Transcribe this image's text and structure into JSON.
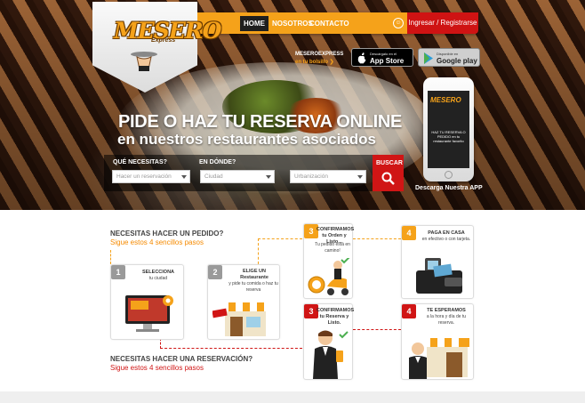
{
  "brand": {
    "logo_text": "MESERO",
    "logo_sub": "Express"
  },
  "nav": {
    "items": [
      {
        "label": "HOME",
        "active": true
      },
      {
        "label": "NOSOTROS",
        "active": false
      },
      {
        "label": "CONTACTO",
        "active": false
      }
    ],
    "login_label": "Ingresar / Registrarse"
  },
  "app_promo": {
    "title": "MESEROEXPRESS",
    "subtitle": "en tu bolsillo",
    "appstore": {
      "small": "Descárgalo en el",
      "big": "App Store"
    },
    "gplay": {
      "small": "Disponible en",
      "big": "Google play"
    },
    "phone_logo": "MESERO",
    "phone_text": "HAZ TU RESERVA O PEDIDO en tu restaurante favorito",
    "caption": "Descarga Nuestra APP"
  },
  "hero": {
    "headline": "PIDE O HAZ TU RESERVA ONLINE",
    "subheadline": "en nuestros restaurantes asociados"
  },
  "search": {
    "q_label": "QUÉ NECESITAS?",
    "q_value": "Hacer un reservación",
    "where_label": "EN DÓNDE?",
    "city_value": "Ciudad",
    "zone_value": "Urbanización",
    "button_label": "BUSCAR"
  },
  "howto": {
    "order_q": "NECESITAS HACER UN PEDIDO?",
    "order_sub": "Sigue estos 4 sencillos pasos",
    "reserve_q": "NECESITAS HACER UNA RESERVACIÓN?",
    "reserve_sub": "Sigue estos 4 sencillos pasos",
    "steps": {
      "s1": {
        "num": "1",
        "title": "SELECCIONA",
        "sub": "tu ciudad"
      },
      "s2": {
        "num": "2",
        "title": "ELIGE UN Restaurante",
        "sub": "y pide tu comida o haz tu reserva"
      },
      "s3o": {
        "num": "3",
        "title": "CONFIRMAMOS tu Orden y Listo...",
        "sub": "Tu pedido está en camino!"
      },
      "s4o": {
        "num": "4",
        "title": "PAGA EN CASA",
        "sub": "en efectivo o con tarjeta."
      },
      "s3r": {
        "num": "3",
        "title": "CONFIRMAMOS tu Reserva y Listo.",
        "sub": ""
      },
      "s4r": {
        "num": "4",
        "title": "TE ESPERAMOS",
        "sub": "a la hora y día de tu reserva."
      }
    }
  },
  "colors": {
    "accent": "#f5a21a",
    "red": "#d01515",
    "dark": "#1f1f1f"
  }
}
